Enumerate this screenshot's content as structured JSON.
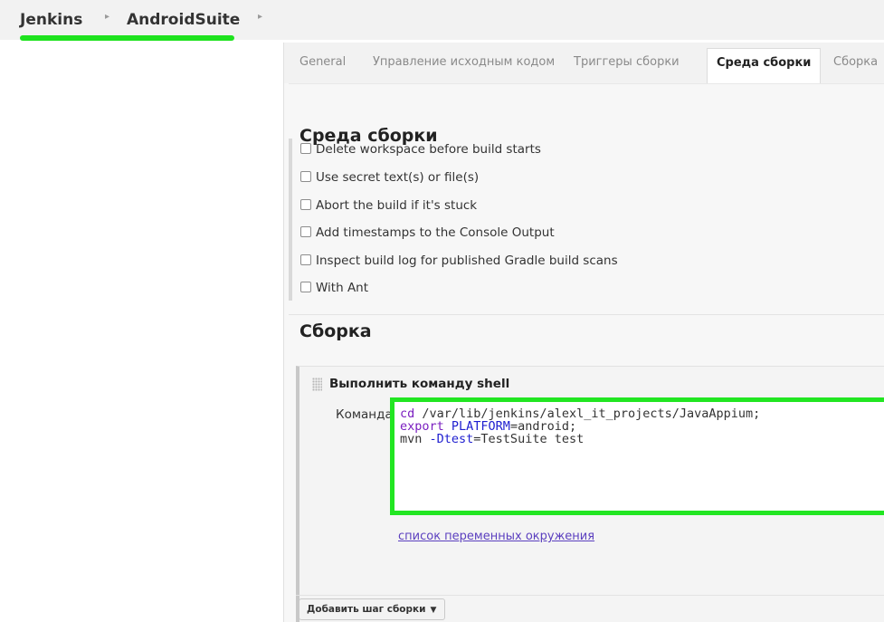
{
  "breadcrumb": {
    "items": [
      "Jenkins",
      "AndroidSuite"
    ],
    "separator": "▸"
  },
  "tabs": [
    {
      "label": "General",
      "active": false
    },
    {
      "label": "Управление исходным кодом",
      "active": false
    },
    {
      "label": "Триггеры сборки",
      "active": false
    },
    {
      "label": "Среда сборки",
      "active": true
    },
    {
      "label": "Сборка",
      "active": false
    }
  ],
  "build_env": {
    "title": "Среда сборки",
    "options": [
      {
        "label": "Delete workspace before build starts",
        "checked": false
      },
      {
        "label": "Use secret text(s) or file(s)",
        "checked": false
      },
      {
        "label": "Abort the build if it's stuck",
        "checked": false
      },
      {
        "label": "Add timestamps to the Console Output",
        "checked": false
      },
      {
        "label": "Inspect build log for published Gradle build scans",
        "checked": false
      },
      {
        "label": "With Ant",
        "checked": false
      }
    ]
  },
  "build": {
    "title": "Сборка",
    "step": {
      "title": "Выполнить команду shell",
      "command_label": "Команда",
      "command_lines": [
        {
          "kw": "cd",
          "rest": " /var/lib/jenkins/alexl_it_projects/JavaAppium;"
        },
        {
          "kw": "export",
          "var": " PLATFORM",
          "rest": "=android;"
        },
        {
          "kw": "mvn",
          "var": " -Dtest",
          "rest": "=TestSuite test"
        }
      ],
      "env_link": "список переменных окружения"
    },
    "add_step_label": "Добавить шаг сборки"
  },
  "colors": {
    "highlight": "#22e622",
    "keyword": "#7a1ec0",
    "variable": "#2020d0",
    "link": "#5b3fbf"
  }
}
